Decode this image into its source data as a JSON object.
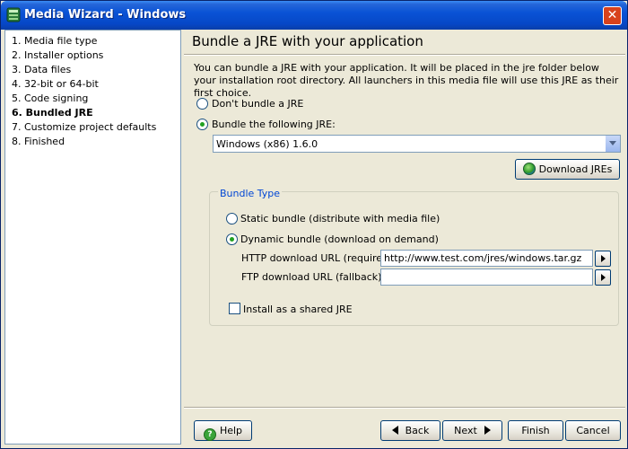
{
  "window": {
    "title": "Media Wizard - Windows",
    "close_glyph": "✕"
  },
  "steps": [
    "1. Media file type",
    "2. Installer options",
    "3. Data files",
    "4. 32-bit or 64-bit",
    "5. Code signing",
    "6. Bundled JRE",
    "7. Customize project defaults",
    "8. Finished"
  ],
  "active_step_index": 5,
  "page": {
    "title": "Bundle a JRE with your application",
    "description": "You can bundle a JRE with your application. It will be placed in the jre folder below your installation root directory. All launchers in this media file will use this JRE as their first choice."
  },
  "bundle_choice": {
    "dont_bundle_label": "Don't bundle a JRE",
    "bundle_label": "Bundle the following JRE:",
    "selected": "bundle"
  },
  "jre_select": {
    "value": "Windows (x86) 1.6.0"
  },
  "download_button": {
    "label": "Download JREs",
    "icon": "globe-icon"
  },
  "bundle_type": {
    "title": "Bundle Type",
    "static_label": "Static bundle (distribute with media file)",
    "dynamic_label": "Dynamic bundle (download on demand)",
    "selected": "dynamic",
    "http_label": "HTTP download URL (required):",
    "http_value": "http://www.test.com/jres/windows.tar.gz",
    "ftp_label": "FTP download URL (fallback):",
    "ftp_value": "",
    "shared_label": "Install as a shared JRE",
    "shared_checked": false
  },
  "footer": {
    "help": "Help",
    "back": "Back",
    "next": "Next",
    "finish": "Finish",
    "cancel": "Cancel"
  },
  "colors": {
    "titlebar": "#0a53d6",
    "dialog_bg": "#ece9d8",
    "group_title": "#0046d5",
    "radio_dot": "#21a121"
  }
}
